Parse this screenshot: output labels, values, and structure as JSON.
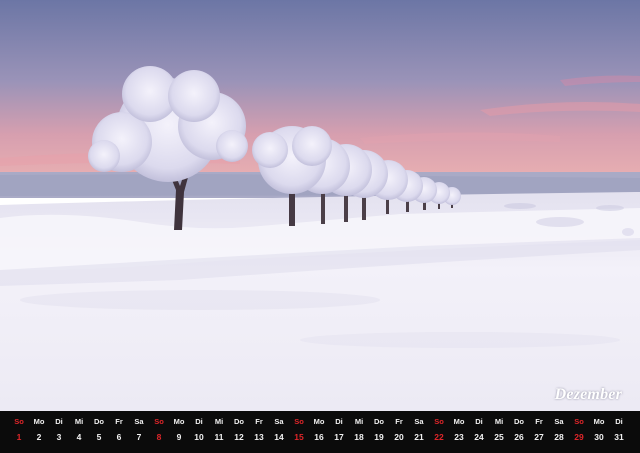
{
  "month": "Dezember",
  "colors": {
    "strip_background": "#0b0b0b",
    "text": "#f2f2f2",
    "sunday": "#e0262a",
    "sky_top": "#6f78a6",
    "sky_horizon": "#e8a0a6",
    "snow": "#f1eff8"
  },
  "calendar": {
    "days": [
      {
        "weekday": "So",
        "date": "1"
      },
      {
        "weekday": "Mo",
        "date": "2"
      },
      {
        "weekday": "Di",
        "date": "3"
      },
      {
        "weekday": "Mi",
        "date": "4"
      },
      {
        "weekday": "Do",
        "date": "5"
      },
      {
        "weekday": "Fr",
        "date": "6"
      },
      {
        "weekday": "Sa",
        "date": "7"
      },
      {
        "weekday": "So",
        "date": "8"
      },
      {
        "weekday": "Mo",
        "date": "9"
      },
      {
        "weekday": "Di",
        "date": "10"
      },
      {
        "weekday": "Mi",
        "date": "11"
      },
      {
        "weekday": "Do",
        "date": "12"
      },
      {
        "weekday": "Fr",
        "date": "13"
      },
      {
        "weekday": "Sa",
        "date": "14"
      },
      {
        "weekday": "So",
        "date": "15"
      },
      {
        "weekday": "Mo",
        "date": "16"
      },
      {
        "weekday": "Di",
        "date": "17"
      },
      {
        "weekday": "Mi",
        "date": "18"
      },
      {
        "weekday": "Do",
        "date": "19"
      },
      {
        "weekday": "Fr",
        "date": "20"
      },
      {
        "weekday": "Sa",
        "date": "21"
      },
      {
        "weekday": "So",
        "date": "22"
      },
      {
        "weekday": "Mo",
        "date": "23"
      },
      {
        "weekday": "Di",
        "date": "24"
      },
      {
        "weekday": "Mi",
        "date": "25"
      },
      {
        "weekday": "Do",
        "date": "26"
      },
      {
        "weekday": "Fr",
        "date": "27"
      },
      {
        "weekday": "Sa",
        "date": "28"
      },
      {
        "weekday": "So",
        "date": "29"
      },
      {
        "weekday": "Mo",
        "date": "30"
      },
      {
        "weekday": "Di",
        "date": "31"
      }
    ]
  }
}
